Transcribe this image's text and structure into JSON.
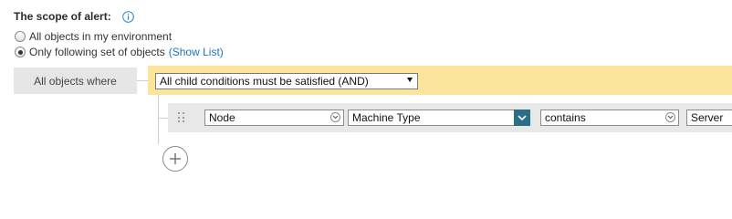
{
  "scope": {
    "title": "The scope of alert:",
    "option_all": "All objects in my environment",
    "option_following": "Only following set of objects",
    "show_list": "(Show List)"
  },
  "where_label": "All objects where",
  "group": {
    "logic_value": "All child conditions must be satisfied (AND)"
  },
  "condition": {
    "object": "Node",
    "property": "Machine Type",
    "operator": "contains",
    "value": "Server"
  },
  "icons": {
    "info": "info-icon",
    "add": "plus-icon",
    "drag": "drag-handle-icon"
  },
  "colors": {
    "accent": "#2a6f87",
    "group_bar": "#fbe49b",
    "link": "#1a73b8"
  }
}
